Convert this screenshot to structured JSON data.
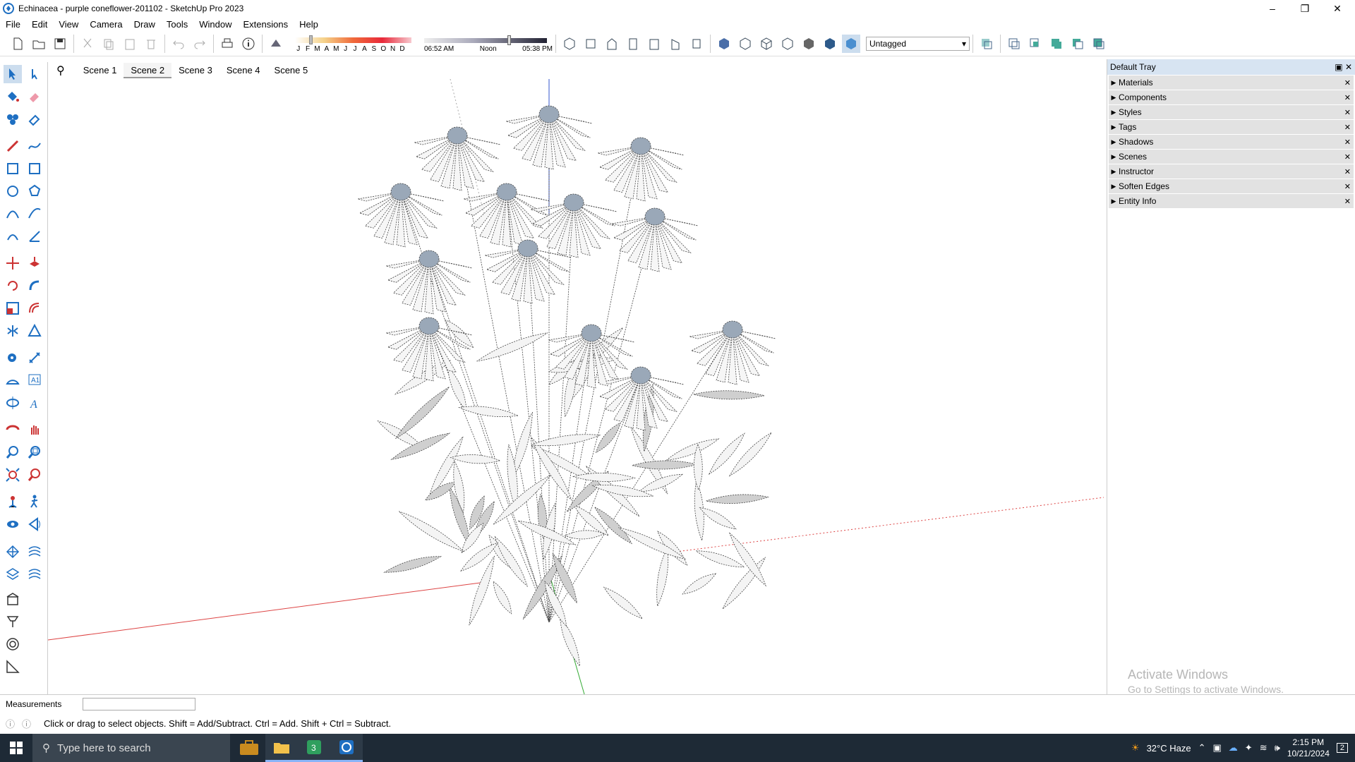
{
  "window": {
    "title": "Echinacea - purple coneflower-201102 - SketchUp Pro 2023",
    "minimize": "–",
    "maximize": "❐",
    "close": "✕"
  },
  "menu": [
    "File",
    "Edit",
    "View",
    "Camera",
    "Draw",
    "Tools",
    "Window",
    "Extensions",
    "Help"
  ],
  "toolbar": {
    "months": [
      "J",
      "F",
      "M",
      "A",
      "M",
      "J",
      "J",
      "A",
      "S",
      "O",
      "N",
      "D"
    ],
    "time_start": "06:52 AM",
    "time_mid": "Noon",
    "time_end": "05:38 PM",
    "tag": "Untagged"
  },
  "scenes": {
    "tabs": [
      "Scene 1",
      "Scene 2",
      "Scene 3",
      "Scene 4",
      "Scene 5"
    ],
    "active": "Scene 2"
  },
  "tray": {
    "title": "Default Tray",
    "items": [
      "Materials",
      "Components",
      "Styles",
      "Tags",
      "Shadows",
      "Scenes",
      "Instructor",
      "Soften Edges",
      "Entity Info"
    ]
  },
  "activate": {
    "line1": "Activate Windows",
    "line2": "Go to Settings to activate Windows."
  },
  "measurements": {
    "label": "Measurements",
    "value": ""
  },
  "status": {
    "hint": "Click or drag to select objects. Shift = Add/Subtract. Ctrl = Add. Shift + Ctrl = Subtract."
  },
  "taskbar": {
    "search_placeholder": "Type here to search",
    "weather": "32°C  Haze",
    "time": "2:15 PM",
    "date": "10/21/2024",
    "notifications": "2"
  },
  "colors": {
    "accent": "#1e6fc2",
    "taskbar": "#1e2a36",
    "tray_header": "#d7e4f2"
  }
}
